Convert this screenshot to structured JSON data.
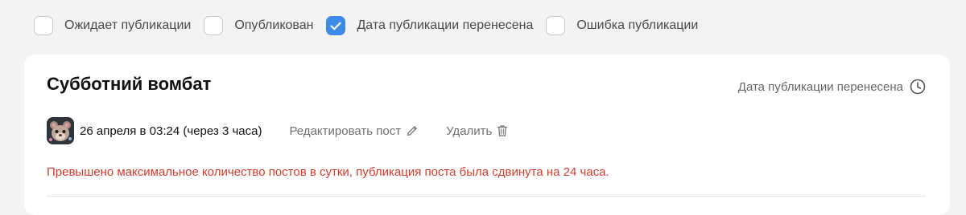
{
  "filters": [
    {
      "label": "Ожидает публикации",
      "checked": false
    },
    {
      "label": "Опубликован",
      "checked": false
    },
    {
      "label": "Дата публикации перенесена",
      "checked": true
    },
    {
      "label": "Ошибка публикации",
      "checked": false
    }
  ],
  "post": {
    "title": "Субботний вомбат",
    "status": "Дата публикации перенесена",
    "status_icon": "clock-icon",
    "date": "26 апреля в 03:24 (через 3 часа)",
    "edit_label": "Редактировать пост",
    "edit_icon": "pencil-icon",
    "delete_label": "Удалить",
    "delete_icon": "trash-icon",
    "error": "Превышено максимальное количество постов в сутки, публикация поста была сдвинута на 24 часа."
  },
  "colors": {
    "accent": "#3d8ae8",
    "error": "#d93a2b",
    "muted": "#707070"
  }
}
